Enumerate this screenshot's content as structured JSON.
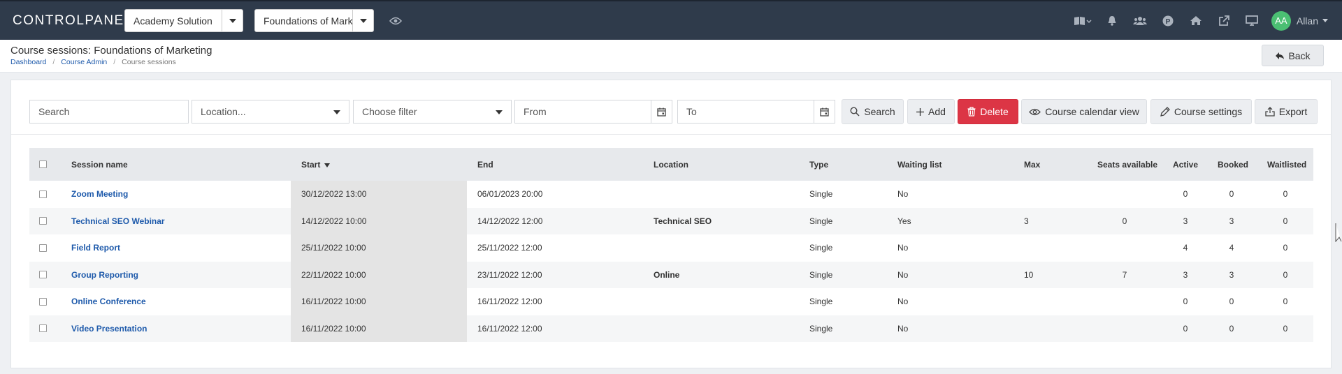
{
  "topbar": {
    "brand": "CONTROLPANEL",
    "org_select": "Academy Solution",
    "course_select": "Foundations of Mark",
    "user_initials": "AA",
    "user_name": "Allan"
  },
  "header": {
    "title": "Course sessions: Foundations of Marketing",
    "breadcrumb": [
      "Dashboard",
      "Course Admin",
      "Course sessions"
    ],
    "back_label": "Back"
  },
  "toolbar": {
    "search_placeholder": "Search",
    "location_placeholder": "Location...",
    "filter_placeholder": "Choose filter",
    "from_placeholder": "From",
    "to_placeholder": "To",
    "search_btn": "Search",
    "add_btn": "Add",
    "delete_btn": "Delete",
    "calendar_btn": "Course calendar view",
    "settings_btn": "Course settings",
    "export_btn": "Export"
  },
  "table": {
    "headers": {
      "name": "Session name",
      "start": "Start",
      "end": "End",
      "location": "Location",
      "type": "Type",
      "waiting": "Waiting list",
      "max": "Max",
      "seats": "Seats available",
      "active": "Active",
      "booked": "Booked",
      "waitlisted": "Waitlisted"
    },
    "rows": [
      {
        "name": "Zoom Meeting",
        "start": "30/12/2022 13:00",
        "end": "06/01/2023 20:00",
        "location": "",
        "type": "Single",
        "waiting": "No",
        "max": "",
        "seats": "",
        "active": "0",
        "booked": "0",
        "waitlisted": "0"
      },
      {
        "name": "Technical SEO Webinar",
        "start": "14/12/2022 10:00",
        "end": "14/12/2022 12:00",
        "location": "Technical SEO",
        "type": "Single",
        "waiting": "Yes",
        "max": "3",
        "seats": "0",
        "active": "3",
        "booked": "3",
        "waitlisted": "0"
      },
      {
        "name": "Field Report",
        "start": "25/11/2022 10:00",
        "end": "25/11/2022 12:00",
        "location": "",
        "type": "Single",
        "waiting": "No",
        "max": "",
        "seats": "",
        "active": "4",
        "booked": "4",
        "waitlisted": "0"
      },
      {
        "name": "Group Reporting",
        "start": "22/11/2022 10:00",
        "end": "23/11/2022 12:00",
        "location": "Online",
        "type": "Single",
        "waiting": "No",
        "max": "10",
        "seats": "7",
        "active": "3",
        "booked": "3",
        "waitlisted": "0"
      },
      {
        "name": "Online Conference",
        "start": "16/11/2022 10:00",
        "end": "16/11/2022 12:00",
        "location": "",
        "type": "Single",
        "waiting": "No",
        "max": "",
        "seats": "",
        "active": "0",
        "booked": "0",
        "waitlisted": "0"
      },
      {
        "name": "Video Presentation",
        "start": "16/11/2022 10:00",
        "end": "16/11/2022 12:00",
        "location": "",
        "type": "Single",
        "waiting": "No",
        "max": "",
        "seats": "",
        "active": "0",
        "booked": "0",
        "waitlisted": "0"
      }
    ]
  },
  "colors": {
    "topbar": "#2f3b4b",
    "link": "#1e5aab",
    "danger": "#dc3545",
    "avatar": "#4bbf73"
  }
}
